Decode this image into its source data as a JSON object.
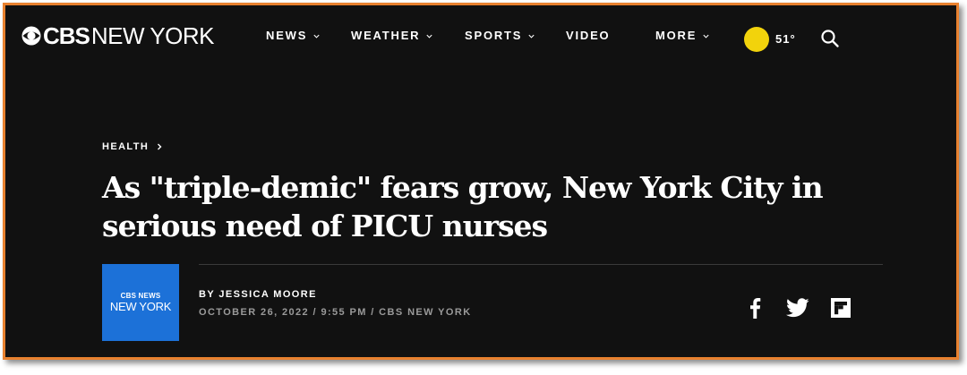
{
  "header": {
    "logo_brand": "CBS",
    "logo_city": "NEW YORK",
    "nav": [
      {
        "label": "NEWS",
        "dropdown": true
      },
      {
        "label": "WEATHER",
        "dropdown": true
      },
      {
        "label": "SPORTS",
        "dropdown": true
      },
      {
        "label": "VIDEO",
        "dropdown": false
      },
      {
        "label": "MORE",
        "dropdown": true
      }
    ],
    "weather": {
      "icon": "sun-icon",
      "temperature": "51°"
    },
    "search_icon": "search-icon"
  },
  "article": {
    "category": "HEALTH",
    "headline": "As \"triple-demic\" fears grow, New York City in serious need of PICU nurses",
    "author_avatar": {
      "top": "CBS NEWS",
      "bottom": "NEW YORK"
    },
    "byline": "BY JESSICA MOORE",
    "dateline": "OCTOBER 26, 2022 / 9:55 PM / CBS NEW YORK",
    "share": [
      "facebook-icon",
      "twitter-icon",
      "flipboard-icon"
    ]
  },
  "colors": {
    "background": "#111111",
    "frame_border": "#e8812f",
    "sun": "#f2d30c",
    "avatar": "#1c71d8",
    "dateline": "#9a9a9a"
  }
}
